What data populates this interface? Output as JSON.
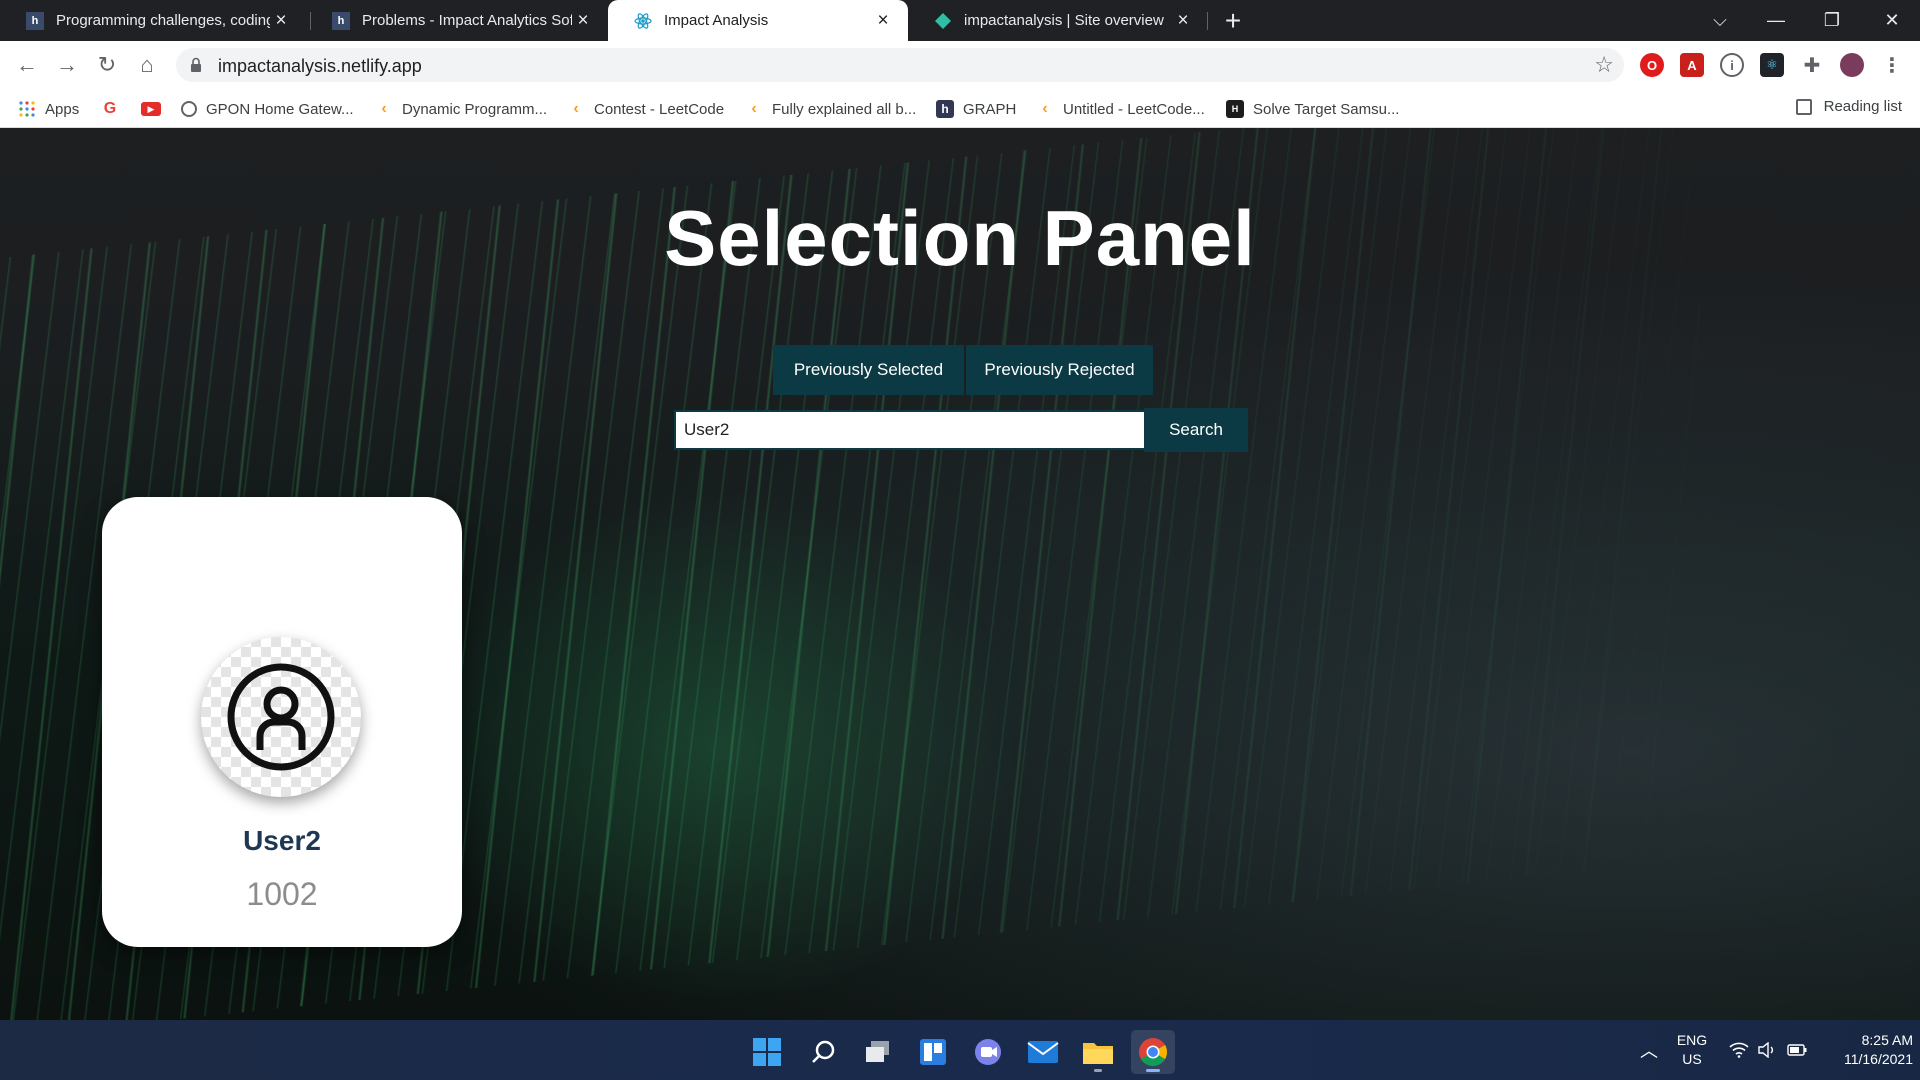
{
  "browser": {
    "tabs": [
      {
        "title": "Programming challenges, coding",
        "favicon": "hackerearth-icon",
        "active": false
      },
      {
        "title": "Problems - Impact Analytics Soft",
        "favicon": "hackerearth-icon",
        "active": false
      },
      {
        "title": "Impact Analysis",
        "favicon": "react-icon",
        "active": true
      },
      {
        "title": "impactanalysis | Site overview",
        "favicon": "netlify-icon",
        "active": false
      }
    ],
    "url": "impactanalysis.netlify.app",
    "bookmarks": [
      {
        "label": "Apps",
        "icon": "apps-grid-icon"
      },
      {
        "label": "",
        "icon": "google-icon"
      },
      {
        "label": "",
        "icon": "youtube-icon"
      },
      {
        "label": "GPON Home Gatew...",
        "icon": "globe-icon"
      },
      {
        "label": "Dynamic Programm...",
        "icon": "leetcode-icon"
      },
      {
        "label": "Contest - LeetCode",
        "icon": "leetcode-icon"
      },
      {
        "label": "Fully explained all b...",
        "icon": "leetcode-icon"
      },
      {
        "label": "GRAPH",
        "icon": "hackerearth-icon"
      },
      {
        "label": "Untitled - LeetCode...",
        "icon": "leetcode-icon"
      },
      {
        "label": "Solve Target Samsu...",
        "icon": "hackerrank-icon"
      }
    ],
    "reading_list": "Reading list"
  },
  "page": {
    "title": "Selection Panel",
    "previously_selected": "Previously Selected",
    "previously_rejected": "Previously Rejected",
    "search_value": "User2",
    "search_button": "Search",
    "card": {
      "name": "User2",
      "id": "1002"
    }
  },
  "taskbar": {
    "lang": "ENG",
    "region": "US",
    "time": "8:25 AM",
    "date": "11/16/2021"
  },
  "colors": {
    "accent": "#0b3a45",
    "card_name": "#1e3854",
    "card_id": "#8c8c8c"
  }
}
